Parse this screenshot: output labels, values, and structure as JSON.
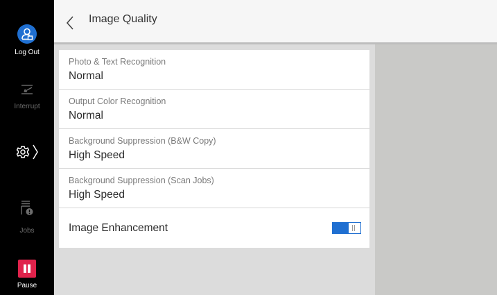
{
  "sidebar": {
    "logout_label": "Log Out",
    "interrupt_label": "Interrupt",
    "jobs_label": "Jobs",
    "pause_label": "Pause",
    "accent_color": "#1f6fd1",
    "pause_color": "#e0224b"
  },
  "header": {
    "title": "Image Quality",
    "back_icon": "chevron-left-icon"
  },
  "settings": [
    {
      "label": "Photo & Text Recognition",
      "value": "Normal"
    },
    {
      "label": "Output Color Recognition",
      "value": "Normal"
    },
    {
      "label": "Background Suppression (B&W Copy)",
      "value": "High Speed"
    },
    {
      "label": "Background Suppression (Scan Jobs)",
      "value": "High Speed"
    }
  ],
  "enhancement": {
    "label": "Image Enhancement",
    "enabled": true
  }
}
